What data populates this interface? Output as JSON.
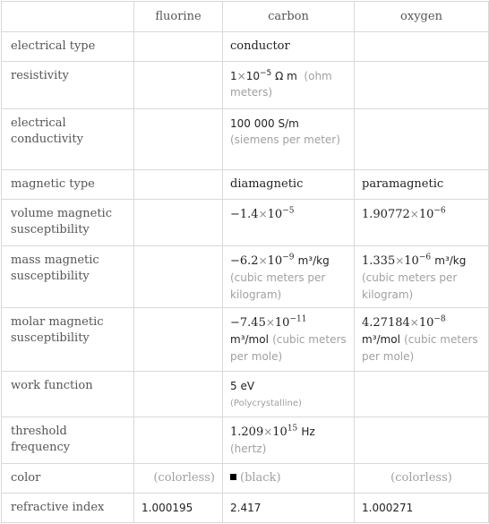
{
  "columns": [
    "",
    "fluorine",
    "carbon",
    "oxygen"
  ],
  "rows": {
    "electrical_type": {
      "label": "electrical type",
      "carbon": "conductor"
    },
    "resistivity": {
      "label": "resistivity",
      "carbon": {
        "mantissa": "1",
        "exp": "−5",
        "unit": "Ω m",
        "unit_desc": "(ohm meters)"
      }
    },
    "electrical_conductivity": {
      "label": "electrical conductivity",
      "carbon": {
        "value": "100 000",
        "unit": "S/m",
        "unit_desc": "(siemens per meter)"
      }
    },
    "magnetic_type": {
      "label": "magnetic type",
      "carbon": "diamagnetic",
      "oxygen": "paramagnetic"
    },
    "volume_magnetic_susceptibility": {
      "label": "volume magnetic susceptibility",
      "carbon": {
        "mantissa": "−1.4",
        "exp": "−5"
      },
      "oxygen": {
        "mantissa": "1.90772",
        "exp": "−6"
      }
    },
    "mass_magnetic_susceptibility": {
      "label": "mass magnetic susceptibility",
      "carbon": {
        "mantissa": "−6.2",
        "exp": "−9",
        "unit": "m³/kg",
        "unit_desc": "(cubic meters per kilogram)"
      },
      "oxygen": {
        "mantissa": "1.335",
        "exp": "−6",
        "unit": "m³/kg",
        "unit_desc": "(cubic meters per kilogram)"
      }
    },
    "molar_magnetic_susceptibility": {
      "label": "molar magnetic susceptibility",
      "carbon": {
        "mantissa": "−7.45",
        "exp": "−11",
        "unit": "m³/mol",
        "unit_desc": "(cubic meters per mole)"
      },
      "oxygen": {
        "mantissa": "4.27184",
        "exp": "−8",
        "unit": "m³/mol",
        "unit_desc": "(cubic meters per mole)"
      }
    },
    "work_function": {
      "label": "work function",
      "carbon": {
        "value": "5",
        "unit": "eV",
        "note": "(Polycrystalline)"
      }
    },
    "threshold_frequency": {
      "label": "threshold frequency",
      "carbon": {
        "mantissa": "1.209",
        "exp": "15",
        "unit": "Hz",
        "unit_desc": "(hertz)"
      }
    },
    "color": {
      "label": "color",
      "fluorine": "(colorless)",
      "carbon": "(black)",
      "carbon_swatch": "#000000",
      "oxygen": "(colorless)"
    },
    "refractive_index": {
      "label": "refractive index",
      "fluorine": "1.000195",
      "carbon": "2.417",
      "oxygen": "1.000271"
    }
  }
}
